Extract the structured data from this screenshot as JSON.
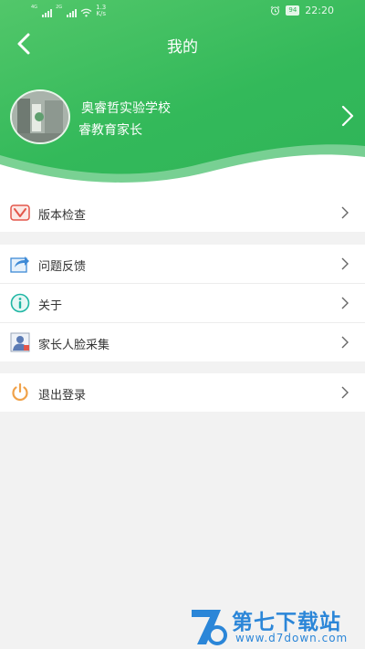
{
  "status_bar": {
    "signal_tag_1": "4G",
    "signal_tag_2": "2G",
    "speed_value": "1.3",
    "speed_unit": "K/s",
    "battery": "94",
    "time": "22:20"
  },
  "nav": {
    "title": "我的"
  },
  "profile": {
    "school": "奥睿哲实验学校",
    "role": "睿教育家长"
  },
  "menu_groups": [
    {
      "items": [
        {
          "label": "版本检查",
          "icon": "version-check-icon"
        }
      ]
    },
    {
      "items": [
        {
          "label": "问题反馈",
          "icon": "feedback-share-icon"
        },
        {
          "label": "关于",
          "icon": "info-icon"
        },
        {
          "label": "家长人脸采集",
          "icon": "face-collect-icon"
        }
      ]
    },
    {
      "items": [
        {
          "label": "退出登录",
          "icon": "power-icon"
        }
      ]
    }
  ],
  "watermark": {
    "title": "第七下载站",
    "url": "www.d7down.com"
  },
  "colors": {
    "header_green": "#33b95a",
    "watermark_blue": "#2b86d8",
    "power_orange": "#f0a24a",
    "info_teal": "#1fb6a4"
  }
}
